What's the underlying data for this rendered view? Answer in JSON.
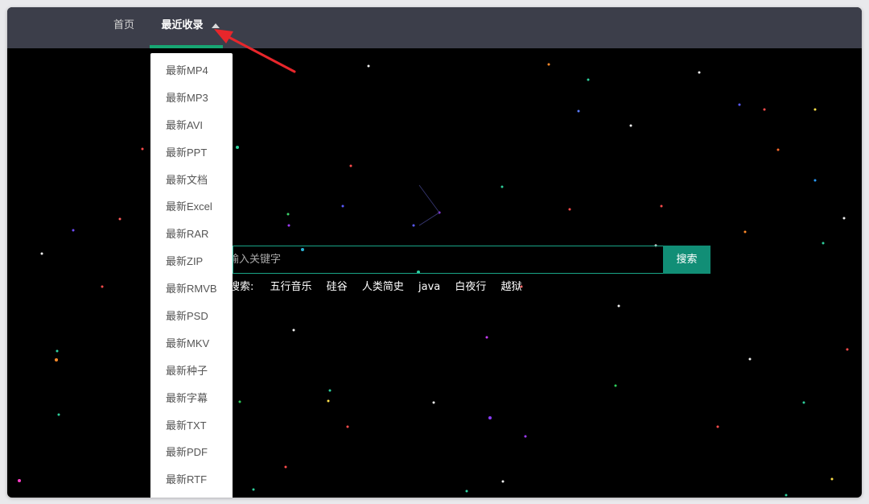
{
  "nav": {
    "home_label": "首页",
    "recent_label": "最近收录"
  },
  "dropdown": {
    "items": [
      "最新MP4",
      "最新MP3",
      "最新AVI",
      "最新PPT",
      "最新文档",
      "最新Excel",
      "最新RAR",
      "最新ZIP",
      "最新RMVB",
      "最新PSD",
      "最新MKV",
      "最新种子",
      "最新字幕",
      "最新TXT",
      "最新PDF",
      "最新RTF"
    ]
  },
  "search": {
    "placeholder": "输入关键字",
    "button_label": "搜索",
    "hot_label": "搜索:",
    "hot_terms": [
      "五行音乐",
      "硅谷",
      "人类简史",
      "java",
      "白夜行",
      "越狱"
    ]
  },
  "colors": {
    "nav_bg": "#3c3e4a",
    "accent_green": "#17a673",
    "button_green": "#118e76",
    "annotation_red": "#e8262b"
  }
}
